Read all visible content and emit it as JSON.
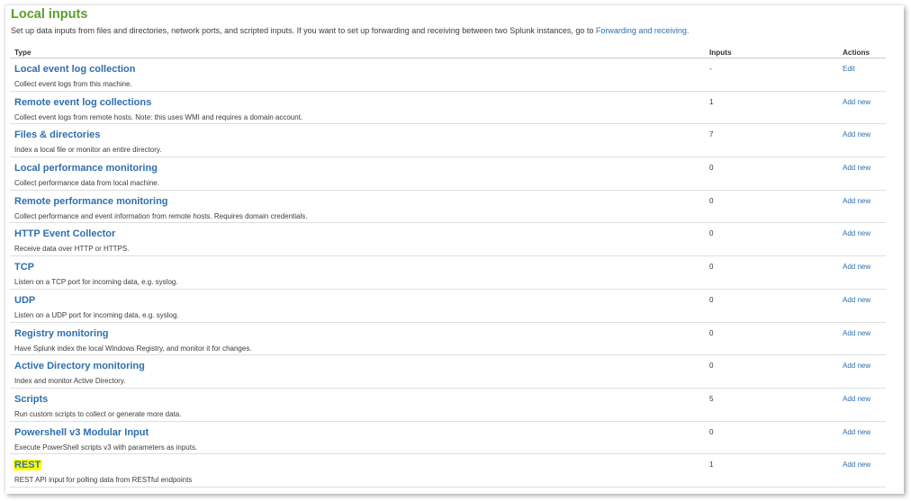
{
  "header": {
    "title": "Local inputs",
    "subtitle": "Set up data inputs from files and directories, network ports, and scripted inputs. If you want to set up forwarding and receiving between two Splunk instances, go to",
    "subtitle_link": "Forwarding and receiving."
  },
  "table": {
    "columns": {
      "type": "Type",
      "inputs": "Inputs",
      "actions": "Actions"
    },
    "rows": [
      {
        "name": "Local event log collection",
        "description": "Collect event logs from this machine.",
        "inputs": "-",
        "action": "Edit"
      },
      {
        "name": "Remote event log collections",
        "description": "Collect event logs from remote hosts. Note: this uses WMI and requires a domain account.",
        "inputs": "1",
        "action": "Add new"
      },
      {
        "name": "Files & directories",
        "description": "Index a local file or monitor an entire directory.",
        "inputs": "7",
        "action": "Add new"
      },
      {
        "name": "Local performance monitoring",
        "description": "Collect performance data from local machine.",
        "inputs": "0",
        "action": "Add new"
      },
      {
        "name": "Remote performance monitoring",
        "description": "Collect performance and event information from remote hosts. Requires domain credentials.",
        "inputs": "0",
        "action": "Add new"
      },
      {
        "name": "HTTP Event Collector",
        "description": "Receive data over HTTP or HTTPS.",
        "inputs": "0",
        "action": "Add new"
      },
      {
        "name": "TCP",
        "description": "Listen on a TCP port for incoming data, e.g. syslog.",
        "inputs": "0",
        "action": "Add new"
      },
      {
        "name": "UDP",
        "description": "Listen on a UDP port for incoming data, e.g. syslog.",
        "inputs": "0",
        "action": "Add new"
      },
      {
        "name": "Registry monitoring",
        "description": "Have Splunk index the local Windows Registry, and monitor it for changes.",
        "inputs": "0",
        "action": "Add new"
      },
      {
        "name": "Active Directory monitoring",
        "description": "Index and monitor Active Directory.",
        "inputs": "0",
        "action": "Add new"
      },
      {
        "name": "Scripts",
        "description": "Run custom scripts to collect or generate more data.",
        "inputs": "5",
        "action": "Add new"
      },
      {
        "name": "Powershell v3 Modular Input",
        "description": "Execute PowerShell scripts v3 with parameters as inputs.",
        "inputs": "0",
        "action": "Add new"
      },
      {
        "name": "REST",
        "description": "REST API input for polling data from RESTful endpoints",
        "inputs": "1",
        "action": "Add new",
        "highlighted": true
      }
    ]
  },
  "colors": {
    "title": "#5a9e2c",
    "link": "#2f6fae",
    "highlight": "#ffff00"
  }
}
